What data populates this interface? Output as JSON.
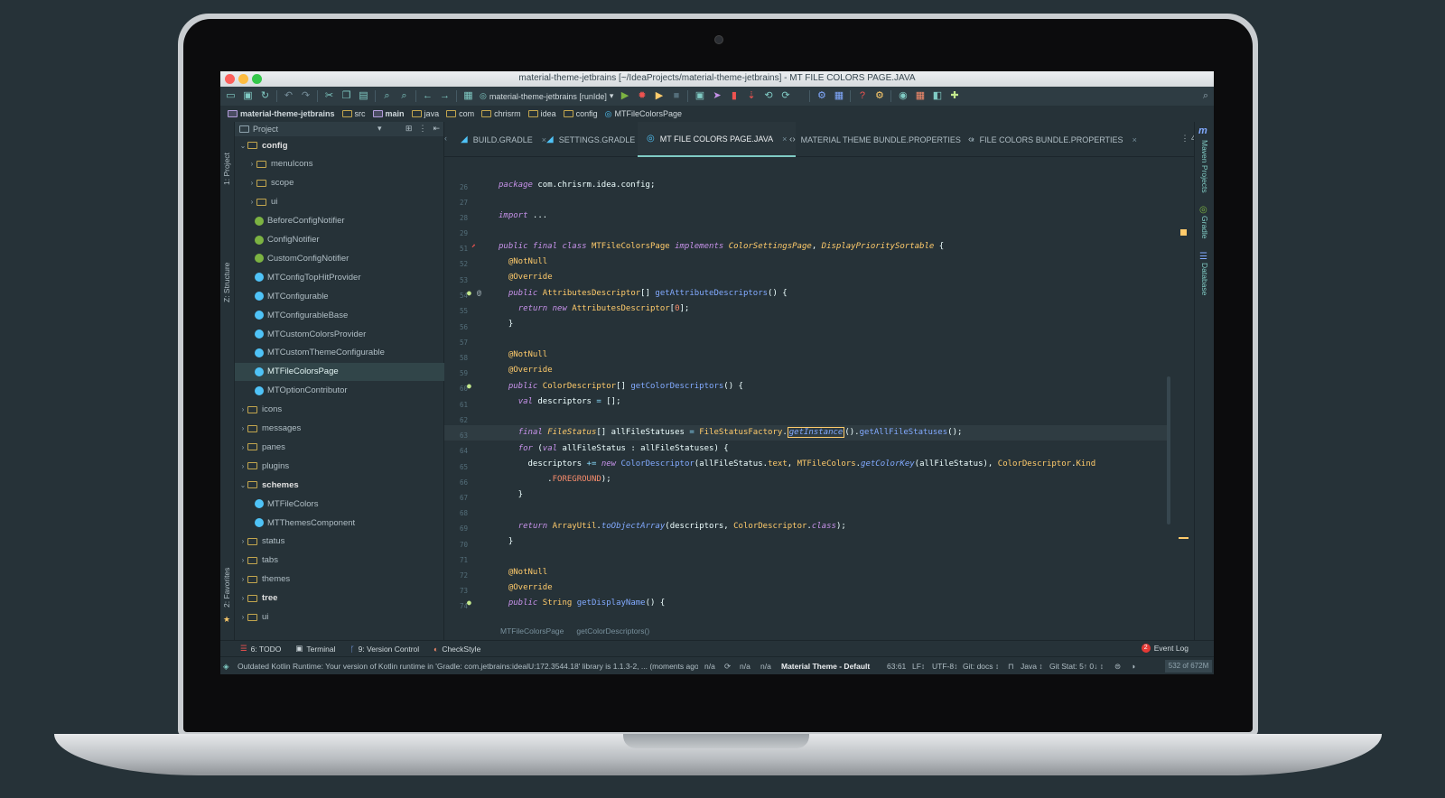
{
  "window": {
    "title": "material-theme-jetbrains [~/IdeaProjects/material-theme-jetbrains] - MT FILE COLORS PAGE.JAVA"
  },
  "toolbar": {
    "run_config": "material-theme-jetbrains [runIde]"
  },
  "breadcrumbs": [
    "material-theme-jetbrains",
    "src",
    "main",
    "java",
    "com",
    "chrisrm",
    "idea",
    "config",
    "MTFileColorsPage"
  ],
  "left_stripe": {
    "project": "1: Project",
    "structure": "Z: Structure",
    "favorites": "2: Favorites"
  },
  "right_stripe": {
    "maven": "Maven Projects",
    "gradle": "Gradle",
    "database": "Database"
  },
  "project_panel": {
    "header": "Project",
    "tree": [
      {
        "label": "config",
        "kind": "folder",
        "expanded": true,
        "bold": true
      },
      {
        "label": "menuIcons",
        "kind": "folder",
        "expanded": false
      },
      {
        "label": "scope",
        "kind": "folder",
        "expanded": false
      },
      {
        "label": "ui",
        "kind": "folder",
        "expanded": false
      },
      {
        "label": "BeforeConfigNotifier",
        "kind": "interface"
      },
      {
        "label": "ConfigNotifier",
        "kind": "interface"
      },
      {
        "label": "CustomConfigNotifier",
        "kind": "interface"
      },
      {
        "label": "MTConfigTopHitProvider",
        "kind": "class"
      },
      {
        "label": "MTConfigurable",
        "kind": "class"
      },
      {
        "label": "MTConfigurableBase",
        "kind": "class"
      },
      {
        "label": "MTCustomColorsProvider",
        "kind": "class"
      },
      {
        "label": "MTCustomThemeConfigurable",
        "kind": "class"
      },
      {
        "label": "MTFileColorsPage",
        "kind": "class",
        "selected": true
      },
      {
        "label": "MTOptionContributor",
        "kind": "class"
      },
      {
        "label": "icons",
        "kind": "folder",
        "expanded": false
      },
      {
        "label": "messages",
        "kind": "folder",
        "expanded": false
      },
      {
        "label": "panes",
        "kind": "folder",
        "expanded": false
      },
      {
        "label": "plugins",
        "kind": "folder",
        "expanded": false
      },
      {
        "label": "schemes",
        "kind": "folder",
        "expanded": true,
        "bold": true
      },
      {
        "label": "MTFileColors",
        "kind": "class"
      },
      {
        "label": "MTThemesComponent",
        "kind": "class"
      },
      {
        "label": "status",
        "kind": "folder",
        "expanded": false
      },
      {
        "label": "tabs",
        "kind": "folder",
        "expanded": false
      },
      {
        "label": "themes",
        "kind": "folder",
        "expanded": false
      },
      {
        "label": "tree",
        "kind": "folder",
        "expanded": false,
        "bold": true
      },
      {
        "label": "ui",
        "kind": "folder",
        "expanded": false
      }
    ]
  },
  "tabs": [
    {
      "label": "BUILD.GRADLE",
      "active": false
    },
    {
      "label": "SETTINGS.GRADLE",
      "active": false
    },
    {
      "label": "MT FILE COLORS PAGE.JAVA",
      "active": true
    },
    {
      "label": "MATERIAL THEME BUNDLE.PROPERTIES",
      "active": false
    },
    {
      "label": "FILE COLORS BUNDLE.PROPERTIES",
      "active": false
    }
  ],
  "tabs_overflow": "4",
  "editor": {
    "line_numbers": [
      "26",
      "27",
      "28",
      "29",
      "51",
      "52",
      "53",
      "54",
      "55",
      "56",
      "57",
      "58",
      "59",
      "60",
      "61",
      "62",
      "63",
      "64",
      "65",
      "66",
      "67",
      "68",
      "69",
      "70",
      "71",
      "72",
      "73",
      "74"
    ]
  },
  "editor_breadcrumbs": [
    "MTFileColorsPage",
    "getColorDescriptors()"
  ],
  "bottom_tools": {
    "todo": "6: TODO",
    "terminal": "Terminal",
    "vcs": "9: Version Control",
    "checkstyle": "CheckStyle",
    "event_log": "Event Log",
    "event_count": "2"
  },
  "status": {
    "message": "Outdated Kotlin Runtime: Your version of Kotlin runtime in 'Gradle: com.jetbrains:idealU:172.3544.18' library is 1.1.3-2, ... (moments ago)",
    "na1": "n/a",
    "na2": "n/a",
    "na3": "n/a",
    "theme": "Material Theme - Default",
    "position": "63:61",
    "line_sep": "LF↕",
    "encoding": "UTF-8↕",
    "git": "Git: docs ↕",
    "lang": "Java ↕",
    "git_stat": "Git Stat: 5↑ 0↓ ↕",
    "memory": "532 of 672M"
  }
}
